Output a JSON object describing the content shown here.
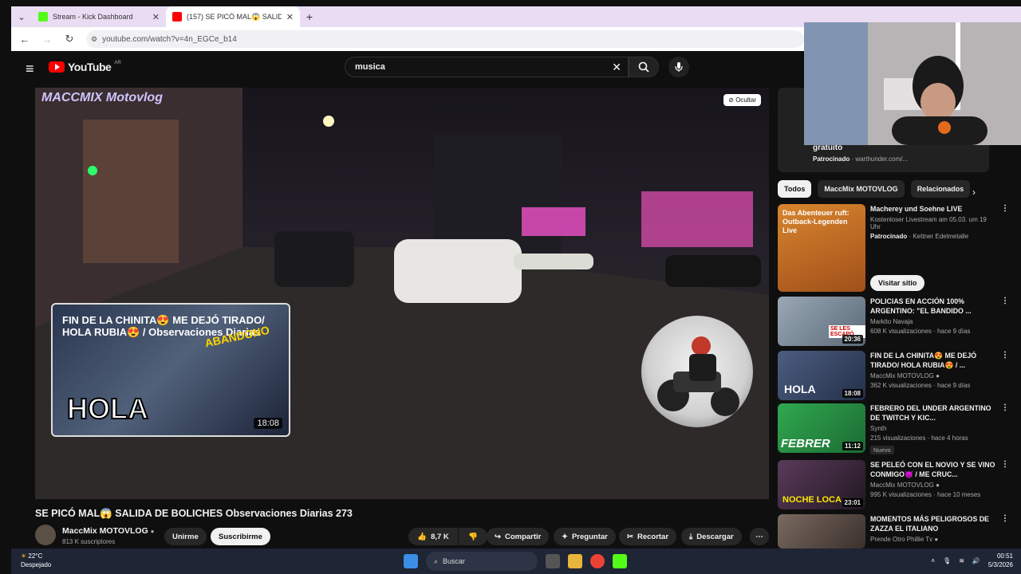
{
  "browser": {
    "tabs": [
      {
        "title": "Stream - Kick Dashboard",
        "color": "#53fc18"
      },
      {
        "title": "(157) SE PICÓ MAL😱 SALIDA D",
        "color": "#ff0000"
      }
    ],
    "url": "youtube.com/watch?v=4n_EGCe_b14"
  },
  "youtube": {
    "logo": "YouTube",
    "country": "AR",
    "search_value": "musica"
  },
  "player": {
    "channel_watermark": "MACCMIX Motovlog",
    "hide_label": "Ocultar",
    "endcard": {
      "title": "FIN DE LA CHINITA😍 ME DEJÓ TIRADO/ HOLA RUBIA😍 / Observaciones Diarias",
      "overlay_text": "HOLA",
      "overlay_text2": "ABANDONO",
      "duration": "18:08"
    }
  },
  "video": {
    "title": "SE PICÓ MAL😱 SALIDA DE BOLICHES Observaciones Diarias 273",
    "channel": "MaccMix MOTOVLOG",
    "subscribers": "813 K suscriptores",
    "join_label": "Unirme",
    "subscribe_label": "Suscribirme",
    "likes": "8,7 K",
    "share_label": "Compartir",
    "ask_label": "Preguntar",
    "clip_label": "Recortar",
    "download_label": "Descargar"
  },
  "sidebar": {
    "ad_top": {
      "title": "gratuito",
      "sponsor": "Patrocinado",
      "domain": "warthunder.com/..."
    },
    "chips": [
      "Todos",
      "MaccMix MOTOVLOG",
      "Relacionados"
    ],
    "items": [
      {
        "title": "Macherey und Soehne LIVE",
        "line2": "Kostenloser Livestream am 05.03. um 19 Uhr",
        "sponsor": "Patrocinado",
        "advertiser": "Kettner Edelmetalle",
        "button": "Visitar sitio",
        "duration": "",
        "thumb_text": "Das Abenteuer ruft: Outback-Legenden Live",
        "thumb_color": "#c56a1a"
      },
      {
        "title": "POLICIAS EN ACCIÓN 100% ARGENTINO: \"EL BANDIDO ...",
        "channel": "Markito Navaja",
        "meta": "608 K visualizaciones · hace 9 días",
        "duration": "20:36",
        "thumb_text": "SE LES ESCAPÓ",
        "thumb_color": "#7a8a9a"
      },
      {
        "title": "FIN DE LA CHINITA😍 ME DEJÓ TIRADO/ HOLA RUBIA😍 / ...",
        "channel": "MaccMix MOTOVLOG",
        "meta": "362 K visualizaciones · hace 9 días",
        "duration": "18:08",
        "thumb_text": "HOLA",
        "thumb_color": "#4d5d80"
      },
      {
        "title": "FEBRERO DEL UNDER ARGENTINO DE TWITCH Y KIC...",
        "channel": "Synth",
        "meta": "215 visualizaciones · hace 4 horas",
        "badge": "Nuevo",
        "duration": "11:12",
        "thumb_text": "FEBRER",
        "thumb_color": "#2fa84f"
      },
      {
        "title": "SE PELEÓ CON EL NOVIO Y SE VINO CONMIGO👿 / ME CRUC...",
        "channel": "MaccMix MOTOVLOG",
        "meta": "995 K visualizaciones · hace 10 meses",
        "duration": "23:01",
        "thumb_text": "NOCHE LOCA",
        "thumb_color": "#3a2a3a"
      },
      {
        "title": "MOMENTOS MÁS PELIGROSOS DE ZAZZA EL ITALIANO",
        "channel": "Prende Otro Phillie Tv",
        "meta": "",
        "duration": "",
        "thumb_text": "",
        "thumb_color": "#5a4a44"
      }
    ]
  },
  "taskbar": {
    "temp": "22°C",
    "weather": "Despejado",
    "search_label": "Buscar",
    "time": "00:51",
    "date": "5/3/2026"
  }
}
